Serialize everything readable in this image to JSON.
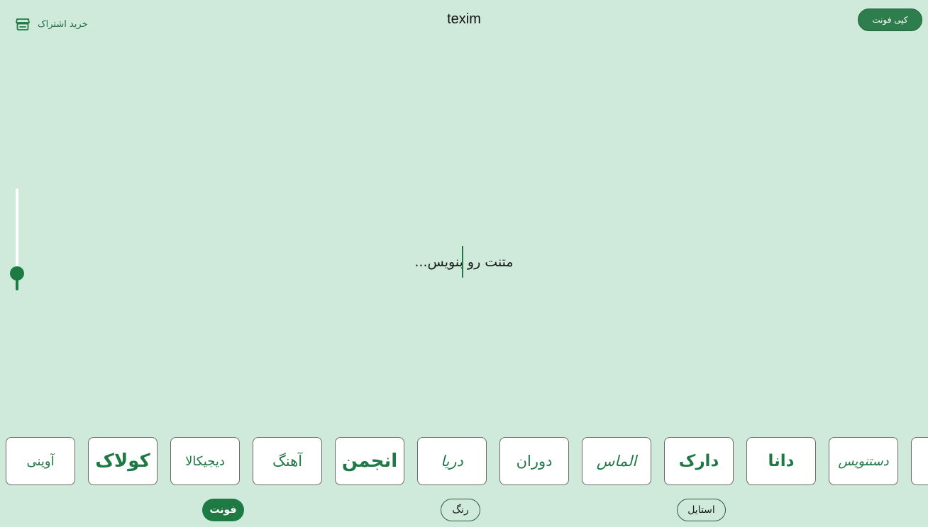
{
  "header": {
    "title": "texim",
    "subscribe_label": "خرید اشتراک",
    "subscribe_icon": "store-icon",
    "copy_font_label": "کپی فونت"
  },
  "editor": {
    "placeholder": "متنت رو بنویس..."
  },
  "size_slider": {
    "value_fraction": 0.1
  },
  "fonts": [
    {
      "label": "آوینی"
    },
    {
      "label": "کولاک"
    },
    {
      "label": "دیجیکالا"
    },
    {
      "label": "آهنگ"
    },
    {
      "label": "انجمن"
    },
    {
      "label": "دریا"
    },
    {
      "label": "دوران"
    },
    {
      "label": "الماس"
    },
    {
      "label": "دارک"
    },
    {
      "label": "دانا"
    },
    {
      "label": "دستنویس"
    }
  ],
  "tabs": [
    {
      "label": "فونت",
      "active": true
    },
    {
      "label": "رنگ",
      "active": false
    },
    {
      "label": "استایل",
      "active": false
    }
  ],
  "colors": {
    "background": "#cfeadb",
    "accent": "#1e7a43",
    "button": "#2e7d4d"
  }
}
